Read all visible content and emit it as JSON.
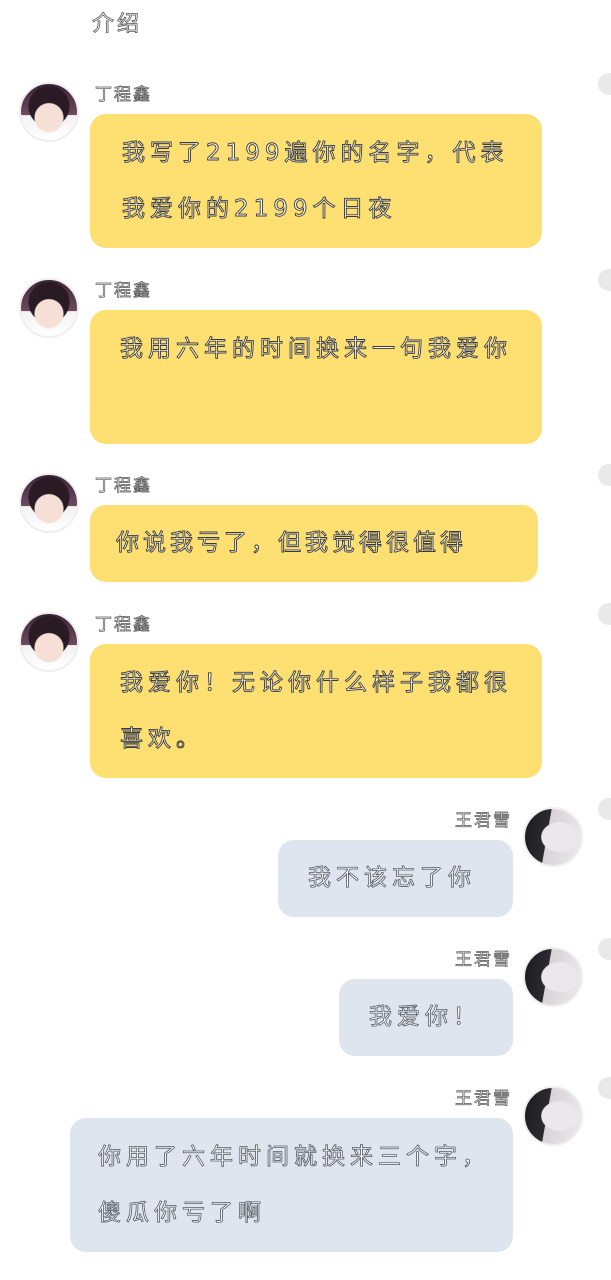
{
  "top_text": "介绍",
  "messages": [
    {
      "sender": "丁程鑫",
      "side": "left",
      "text": "我写了2199遍你的名字，代表我爱你的2199个日夜"
    },
    {
      "sender": "丁程鑫",
      "side": "left",
      "text": "我用六年的时间换来一句我爱你"
    },
    {
      "sender": "丁程鑫",
      "side": "left",
      "text": "你说我亏了，但我觉得很值得"
    },
    {
      "sender": "丁程鑫",
      "side": "left",
      "text": "我爱你！无论你什么样子我都很喜欢。"
    },
    {
      "sender": "王君雪",
      "side": "right",
      "text": "我不该忘了你"
    },
    {
      "sender": "王君雪",
      "side": "right",
      "text": "我爱你！"
    },
    {
      "sender": "王君雪",
      "side": "right",
      "text": "你用了六年时间就换来三个字，傻瓜你亏了啊"
    }
  ],
  "colors": {
    "left_bubble": "#fedf72",
    "right_bubble": "#dfe5ee",
    "background": "#ffffff"
  }
}
